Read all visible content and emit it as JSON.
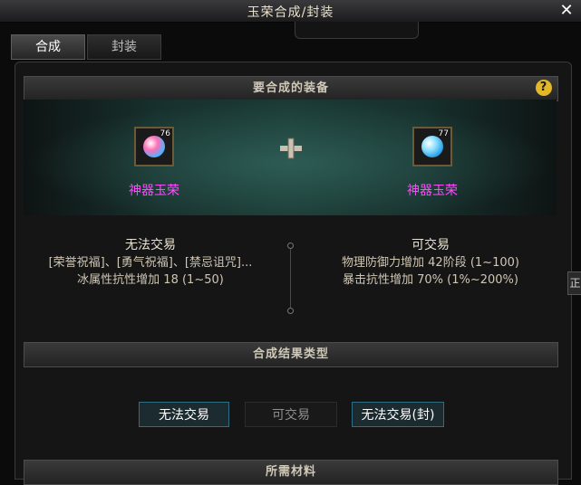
{
  "window": {
    "title": "玉荣合成/封装",
    "close_glyph": "✕"
  },
  "tabs": [
    {
      "label": "合成",
      "active": true
    },
    {
      "label": "封装",
      "active": false
    }
  ],
  "equipment_section": {
    "header": "要合成的装备",
    "help_glyph": "?"
  },
  "items": [
    {
      "name": "神器玉荣",
      "level": "76",
      "color": "#ff4cff",
      "gem_color": "#7ad0ff"
    },
    {
      "name": "神器玉荣",
      "level": "77",
      "color": "#ff4cff",
      "gem_color": "#4fc8ff"
    }
  ],
  "left_info": {
    "head": "无法交易",
    "line1": "[荣誉祝福]、[勇气祝福]、[禁忌诅咒]...",
    "line2": "冰属性抗性增加 18 (1~50)"
  },
  "right_info": {
    "head": "可交易",
    "line1": "物理防御力增加 42阶段 (1~100)",
    "line2": "暴击抗性增加 70% (1%~200%)"
  },
  "result_section": {
    "header": "合成结果类型"
  },
  "result_options": [
    {
      "label": "无法交易",
      "selected": true
    },
    {
      "label": "可交易",
      "selected": false
    },
    {
      "label": "无法交易(封)",
      "selected": true
    }
  ],
  "materials_section": {
    "header": "所需材料"
  },
  "side_button": {
    "label": "正"
  }
}
